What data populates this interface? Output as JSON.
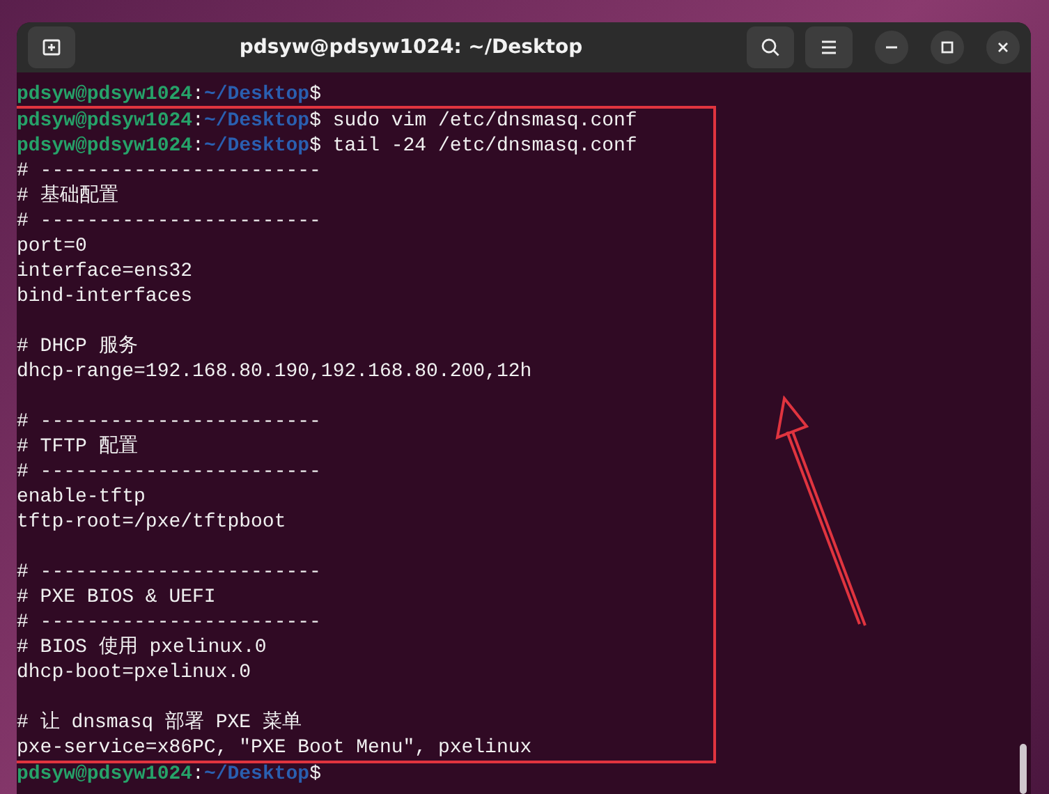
{
  "window": {
    "title": "pdsyw@pdsyw1024: ~/Desktop"
  },
  "terminal": {
    "lines_before": [
      {
        "kind": "prompt",
        "user": "pdsyw@pdsyw1024",
        "separator": ":",
        "path": "~/Desktop",
        "symbol": "$"
      }
    ],
    "highlighted_lines": [
      {
        "kind": "prompt",
        "user": "pdsyw@pdsyw1024",
        "separator": ":",
        "path": "~/Desktop",
        "symbol": "$",
        "command": "sudo vim /etc/dnsmasq.conf"
      },
      {
        "kind": "prompt",
        "user": "pdsyw@pdsyw1024",
        "separator": ":",
        "path": "~/Desktop",
        "symbol": "$",
        "command": "tail -24 /etc/dnsmasq.conf"
      },
      {
        "kind": "output",
        "text": "# ------------------------"
      },
      {
        "kind": "output",
        "text": "# 基础配置"
      },
      {
        "kind": "output",
        "text": "# ------------------------"
      },
      {
        "kind": "output",
        "text": "port=0"
      },
      {
        "kind": "output",
        "text": "interface=ens32"
      },
      {
        "kind": "output",
        "text": "bind-interfaces"
      },
      {
        "kind": "blank"
      },
      {
        "kind": "output",
        "text": "# DHCP 服务"
      },
      {
        "kind": "output",
        "text": "dhcp-range=192.168.80.190,192.168.80.200,12h"
      },
      {
        "kind": "blank"
      },
      {
        "kind": "output",
        "text": "# ------------------------"
      },
      {
        "kind": "output",
        "text": "# TFTP 配置"
      },
      {
        "kind": "output",
        "text": "# ------------------------"
      },
      {
        "kind": "output",
        "text": "enable-tftp"
      },
      {
        "kind": "output",
        "text": "tftp-root=/pxe/tftpboot"
      },
      {
        "kind": "blank"
      },
      {
        "kind": "output",
        "text": "# ------------------------"
      },
      {
        "kind": "output",
        "text": "# PXE BIOS & UEFI"
      },
      {
        "kind": "output",
        "text": "# ------------------------"
      },
      {
        "kind": "output",
        "text": "# BIOS 使用 pxelinux.0"
      },
      {
        "kind": "output",
        "text": "dhcp-boot=pxelinux.0"
      },
      {
        "kind": "blank"
      },
      {
        "kind": "output",
        "text": "# 让 dnsmasq 部署 PXE 菜单"
      },
      {
        "kind": "output",
        "text": "pxe-service=x86PC, \"PXE Boot Menu\", pxelinux"
      }
    ],
    "lines_after": [
      {
        "kind": "prompt",
        "user": "pdsyw@pdsyw1024",
        "separator": ":",
        "path": "~/Desktop",
        "symbol": "$"
      }
    ]
  }
}
